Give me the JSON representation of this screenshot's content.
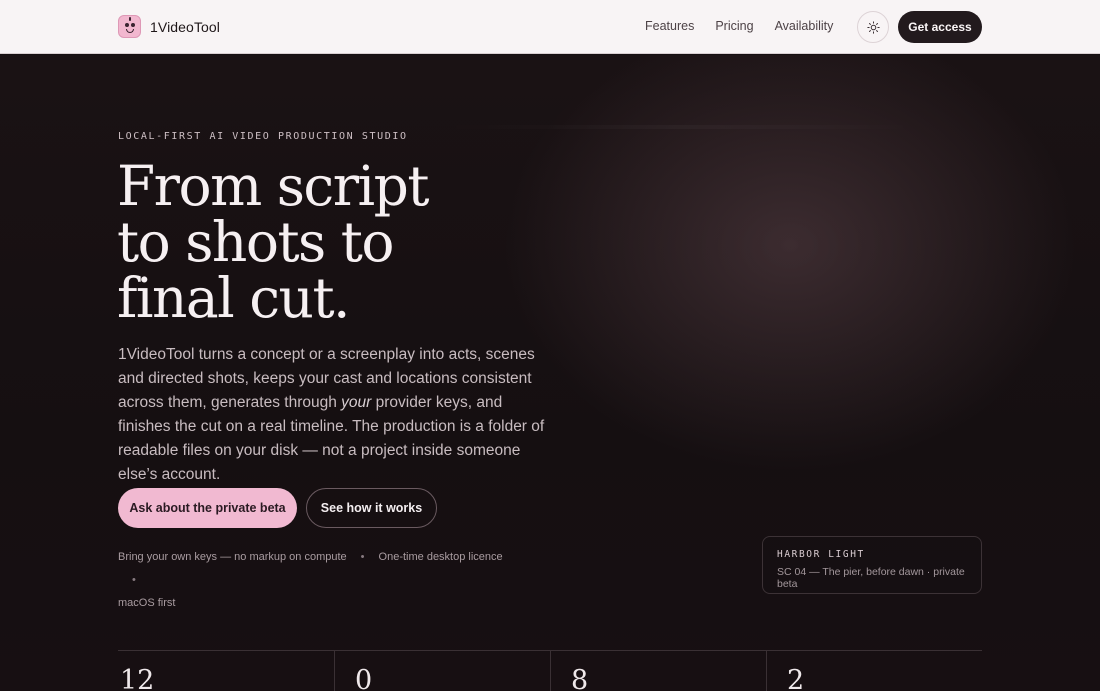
{
  "brand": {
    "name": "1VideoTool"
  },
  "nav": {
    "items": [
      {
        "label": "Features"
      },
      {
        "label": "Pricing"
      },
      {
        "label": "Availability"
      }
    ],
    "theme_icon": "sun-icon",
    "cta_label": "Get access"
  },
  "hero": {
    "eyebrow": "LOCAL-FIRST AI VIDEO PRODUCTION STUDIO",
    "headline": [
      "From script",
      "to shots to",
      "final cut."
    ],
    "lede_before": "1VideoTool turns a concept or a screenplay into acts, scenes and directed shots, keeps your cast and locations consistent across them, generates through ",
    "lede_em": "your",
    "lede_after": " provider keys, and finishes the cut on a real timeline. The production is a folder of readable files on your disk — not a project inside someone else’s account.",
    "primary_cta": "Ask about the private beta",
    "secondary_cta": "See how it works",
    "facts": [
      "Bring your own keys — no markup on compute",
      "One-time desktop licence",
      "macOS first"
    ],
    "fact_separator": "•"
  },
  "card": {
    "title": "HARBOR LIGHT",
    "subtitle": "SC 04 — The pier, before dawn · private beta"
  },
  "stats": [
    {
      "value": "12"
    },
    {
      "value": "0"
    },
    {
      "value": "8"
    },
    {
      "value": "2"
    }
  ],
  "colors": {
    "accent_pink": "#f1b9d1",
    "dark_bg": "#161012",
    "header_bg": "#f8f4f5",
    "cta_dark": "#221a1d"
  }
}
